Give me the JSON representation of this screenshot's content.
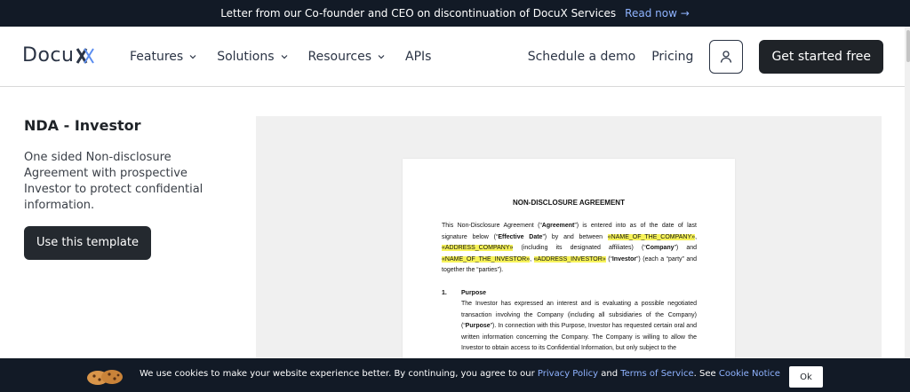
{
  "announcement": {
    "message": "Letter from our Co-founder and CEO on discontinuation of DocuX Services",
    "link": "Read now →"
  },
  "header": {
    "logo_text": "Docu",
    "menu": [
      {
        "label": "Features"
      },
      {
        "label": "Solutions"
      },
      {
        "label": "Resources"
      },
      {
        "label": "APIs"
      }
    ],
    "schedule_demo": "Schedule a demo",
    "pricing": "Pricing",
    "get_started": "Get started free"
  },
  "template": {
    "title": "NDA - Investor",
    "description": "One sided Non-disclosure Agreement with prospective Investor to protect confidential information.",
    "use_button": "Use this template"
  },
  "document": {
    "title": "NON-DISCLOSURE AGREEMENT",
    "intro": {
      "t1": "This Non-Disclosure Agreement (“",
      "b1": "Agreement",
      "t2": "”) is entered into as of the date of last signature below (“",
      "b2": "Effective Date",
      "t3": "”) by and between ",
      "f1": "«NAME_OF_THE_COMPANY»",
      "t4": ", ",
      "f2": "«ADDRESS_COMPANY»",
      "t5": " (including its designated affiliates) (“",
      "b3": "Company",
      "t6": "”) and ",
      "f3": "«NAME_OF_THE_INVESTOR»",
      "t7": ", ",
      "f4": "«ADDRESS_INVESTOR»",
      "t8": " (“",
      "b4": "Investor",
      "t9": "”) (each a “party” and together the “parties”)."
    },
    "section1": {
      "number": "1.",
      "heading": "Purpose",
      "b1": "The Investor has expressed an interest and is evaluating a possible negotiated transaction involving the Company (including all subsidiaries of the Company) (“",
      "bold": "Purpose",
      "b2": "”). In connection with this Purpose, Investor has requested certain oral and written information concerning the Company. The Company is willing to allow the Investor to obtain access to its Confidential Information, but only subject to the"
    }
  },
  "cookie_banner": {
    "text1": "We use cookies to make your website experience better. By continuing, you agree to our ",
    "privacy": "Privacy Policy",
    "and": " and ",
    "terms": "Terms of Service",
    "see": ". See ",
    "notice": "Cookie Notice",
    "ok": "Ok"
  },
  "icons": {
    "user": "user-icon",
    "chevron": "chevron-down-icon",
    "cookie": "cookie-icon"
  },
  "colors": {
    "dark": "#121a26",
    "accent_link": "#8fb3ff",
    "highlight": "#f7f35a"
  }
}
